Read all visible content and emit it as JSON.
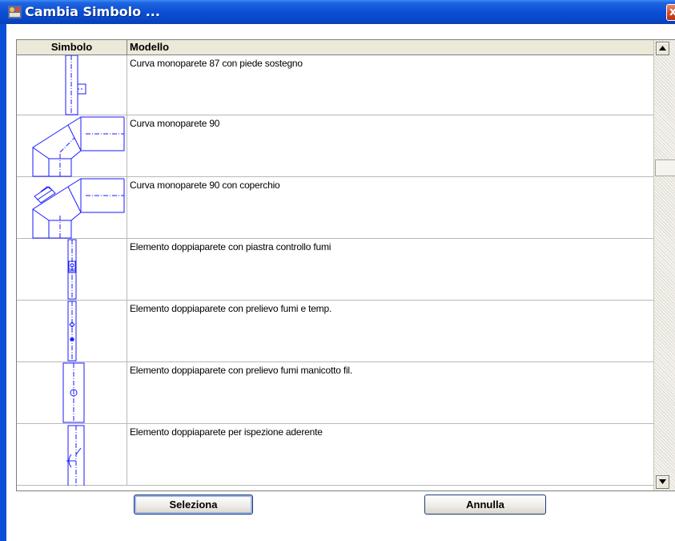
{
  "window": {
    "title": "Cambia Simbolo ...",
    "close_glyph": "x",
    "accent_color": "#0a4fd6"
  },
  "grid": {
    "columns": {
      "symbol": "Simbolo",
      "model": "Modello"
    },
    "rows": [
      {
        "symbol_icon": "elbow-87-support-icon",
        "model": "Curva monoparete 87 con piede sostegno"
      },
      {
        "symbol_icon": "elbow-90-icon",
        "model": "Curva monoparete 90"
      },
      {
        "symbol_icon": "elbow-90-cover-icon",
        "model": "Curva monoparete 90 con coperchio"
      },
      {
        "symbol_icon": "pipe-smoke-plate-icon",
        "model": "Elemento doppiaparete con piastra controllo fumi"
      },
      {
        "symbol_icon": "pipe-smoke-temp-icon",
        "model": "Elemento doppiaparete con prelievo fumi e temp."
      },
      {
        "symbol_icon": "pipe-smoke-sleeve-icon",
        "model": "Elemento doppiaparete con prelievo fumi manicotto fil."
      },
      {
        "symbol_icon": "pipe-inspection-icon",
        "model": "Elemento doppiaparete per ispezione aderente"
      }
    ]
  },
  "buttons": {
    "select": "Seleziona",
    "cancel": "Annulla"
  }
}
